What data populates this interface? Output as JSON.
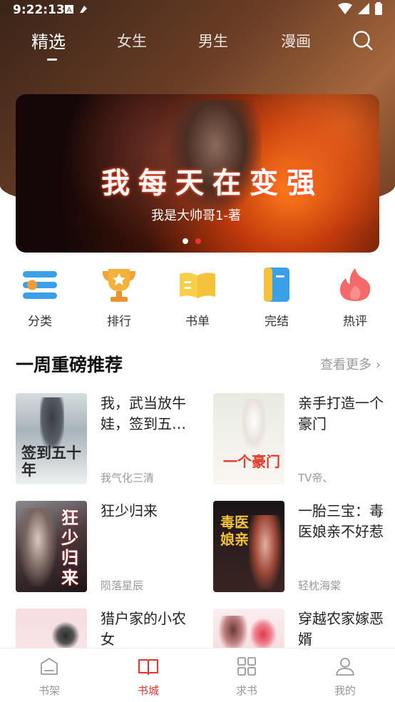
{
  "status_bar": {
    "time": "9:22:13"
  },
  "top_tabs": [
    {
      "label": "精选",
      "active": true
    },
    {
      "label": "女生",
      "active": false
    },
    {
      "label": "男生",
      "active": false
    },
    {
      "label": "漫画",
      "active": false
    }
  ],
  "banner": {
    "title": "我每天在变强",
    "author": "我是大帅哥1-著",
    "slide_count": 2,
    "active_slide": 2
  },
  "quick_links": [
    {
      "label": "分类",
      "icon": "category-icon"
    },
    {
      "label": "排行",
      "icon": "trophy-icon"
    },
    {
      "label": "书单",
      "icon": "book-list-icon"
    },
    {
      "label": "完结",
      "icon": "finished-book-icon"
    },
    {
      "label": "热评",
      "icon": "hot-comment-icon"
    }
  ],
  "section": {
    "title": "一周重磅推荐",
    "see_more": "查看更多",
    "chevron": "›"
  },
  "books": [
    {
      "title": "我，武当放牛娃，签到五十年",
      "author": "我气化三清",
      "cover_text": "签到五十年"
    },
    {
      "title": "亲手打造一个豪门",
      "author": "TV帝、",
      "cover_text": "一个豪门"
    },
    {
      "title": "狂少归来",
      "author": "陨落星辰",
      "cover_text": "狂少归来"
    },
    {
      "title": "一胎三宝：毒医娘亲不好惹",
      "author": "轻枕海棠",
      "cover_text": "毒医娘亲"
    },
    {
      "title": "猎户家的小农女",
      "author": "",
      "cover_text": ""
    },
    {
      "title": "穿越农家嫁恶婿",
      "author": "",
      "cover_text": ""
    }
  ],
  "bottom_nav": [
    {
      "label": "书架",
      "icon": "bookshelf-icon",
      "active": false
    },
    {
      "label": "书城",
      "icon": "book-store-icon",
      "active": true
    },
    {
      "label": "求书",
      "icon": "request-book-icon",
      "active": false
    },
    {
      "label": "我的",
      "icon": "profile-icon",
      "active": false
    }
  ],
  "colors": {
    "accent": "#e8322e",
    "header_brown": "#6b3e26",
    "text_muted": "#999999"
  }
}
